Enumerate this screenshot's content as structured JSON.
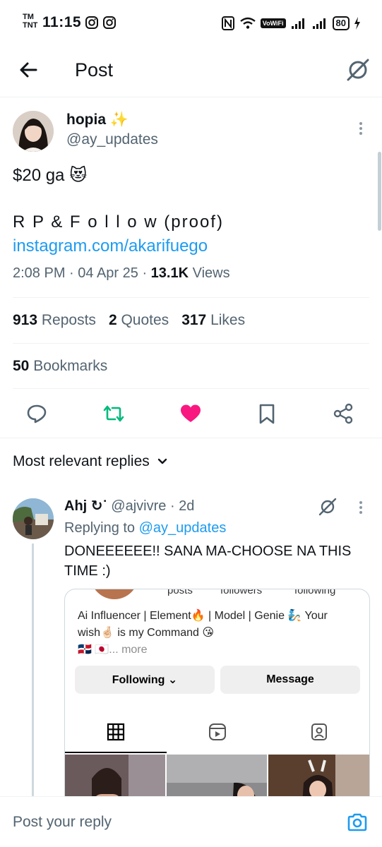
{
  "status_bar": {
    "carrier_top": "TM",
    "carrier_bottom": "TNT",
    "time": "11:15",
    "vowifi": "VoWiFi",
    "battery": "80"
  },
  "header": {
    "title": "Post"
  },
  "post": {
    "author_name": "hopia ✨",
    "author_handle": "@ay_updates",
    "text_line1": "$20 ga 😻",
    "text_line2": "R P & F o l l o w (proof)",
    "link": "instagram.com/akarifuego",
    "time": "2:08 PM · 04 Apr 25 · ",
    "views_count": "13.1K",
    "views_label": " Views",
    "reposts_count": "913",
    "reposts_label": "Reposts",
    "quotes_count": "2",
    "quotes_label": "Quotes",
    "likes_count": "317",
    "likes_label": "Likes",
    "bookmarks_count": "50",
    "bookmarks_label": "Bookmarks"
  },
  "replies_header": "Most relevant replies",
  "reply": {
    "name": "Ahj ↻ᐝ",
    "handle_time": "@ajvivre · 2d",
    "replying_prefix": "Replying to ",
    "replying_to": "@ay_updates",
    "text": "DONEEEEEE!! SANA MA-CHOOSE NA THIS TIME :)"
  },
  "embed": {
    "stat_posts": "posts",
    "stat_followers": "followers",
    "stat_following": "following",
    "bio_line1": "Ai Influencer | Element🔥 |  Model | Genie 🧞 Your",
    "bio_line2": "wish🤞🏻 is my Command 😘",
    "bio_line3_prefix": "🇩🇴 🇯🇵",
    "bio_more": "... more",
    "following_btn": "Following ⌄",
    "message_btn": "Message"
  },
  "reply_bar": {
    "placeholder": "Post your reply"
  },
  "colors": {
    "accent": "#1d9bf0",
    "repost_green": "#00ba7c",
    "like_pink": "#f91880",
    "muted": "#536471"
  }
}
